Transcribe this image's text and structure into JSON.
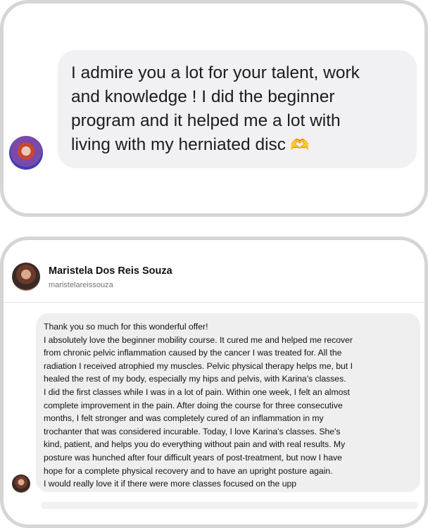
{
  "message_one": {
    "lines": [
      "I admire you a lot for your talent, work",
      "and knowledge ! I did the beginner",
      "program and it helped me a lot with",
      "living with my herniated disc"
    ],
    "emoji": "🫶"
  },
  "profile": {
    "name": "Maristela Dos Reis Souza",
    "handle": "maristelareissouza"
  },
  "message_two": {
    "lines": [
      "Thank you so much for this wonderful offer!",
      "I absolutely love the beginner mobility course. It cured me and helped me recover",
      "from chronic pelvic inflammation caused by the cancer I was treated for. All the",
      "radiation I received atrophied my muscles. Pelvic physical therapy helps me, but I",
      "healed the rest of my body, especially my hips and pelvis, with Karina's classes.",
      "I did the first classes while I was in a lot of pain. Within one week, I felt an almost",
      "complete improvement in the pain. After doing the course for three consecutive",
      "months, I felt stronger and was completely cured of an inflammation in my",
      "trochanter that was considered incurable. Today, I love Karina's classes. She's",
      "kind, patient, and helps you do everything without pain and with real results. My",
      "posture was hunched after four difficult years of post-treatment, but now I have",
      "hope for a complete physical recovery and to have an upright posture again.",
      "I would really love it if there were more classes focused on the upp"
    ]
  }
}
